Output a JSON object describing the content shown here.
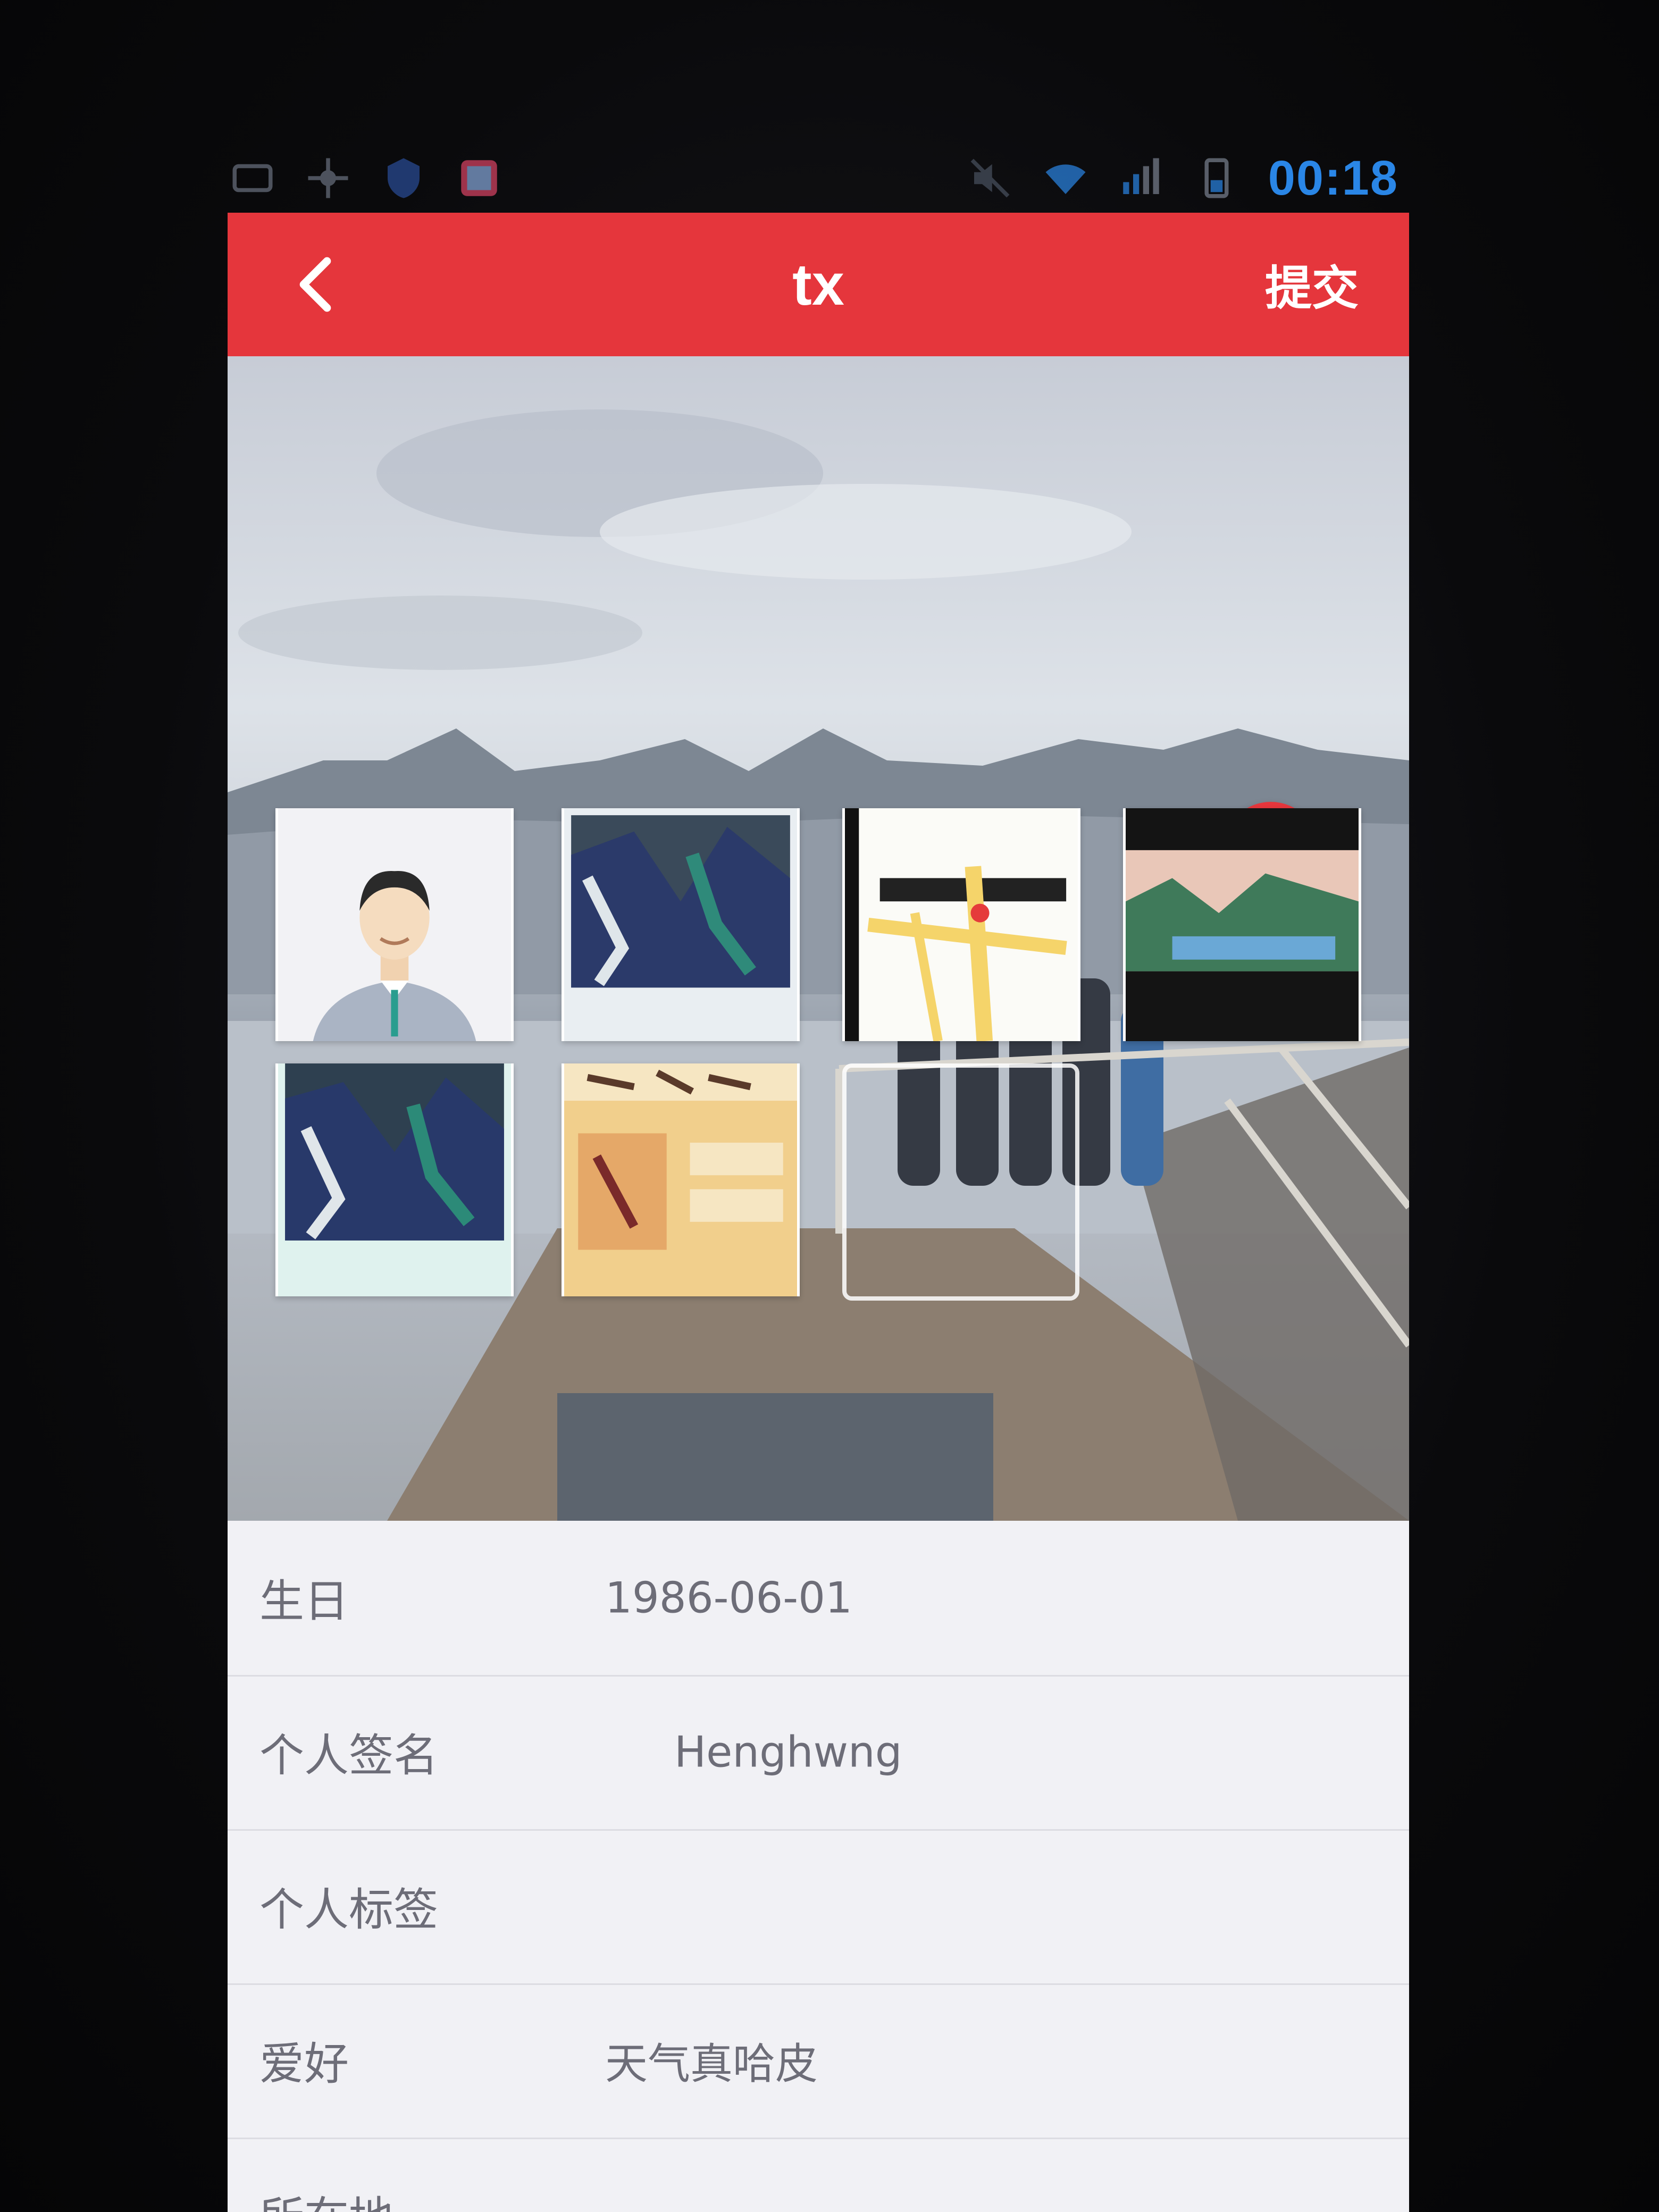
{
  "status_bar": {
    "time": "00:18"
  },
  "app_bar": {
    "title": "tx",
    "back_icon": "chevron-left-icon",
    "submit_label": "提交"
  },
  "hero": {
    "mic_icon": "microphone-icon"
  },
  "photos": [
    {
      "name": "photo-avatar"
    },
    {
      "name": "photo-artwork"
    },
    {
      "name": "photo-map"
    },
    {
      "name": "photo-landscape"
    },
    {
      "name": "photo-artwork-2"
    },
    {
      "name": "photo-calligraphy"
    },
    {
      "name": "photo-add-slot"
    }
  ],
  "profile": {
    "rows": [
      {
        "label": "生日",
        "value": "1986-06-01"
      },
      {
        "label": "个人签名",
        "value": "Henghwng"
      },
      {
        "label": "个人标签",
        "value": ""
      },
      {
        "label": "爱好",
        "value": "天气真哈皮"
      },
      {
        "label": "所在地",
        "value": ""
      }
    ]
  },
  "colors": {
    "accent": "#e5363c",
    "status": "#2a86e6"
  }
}
